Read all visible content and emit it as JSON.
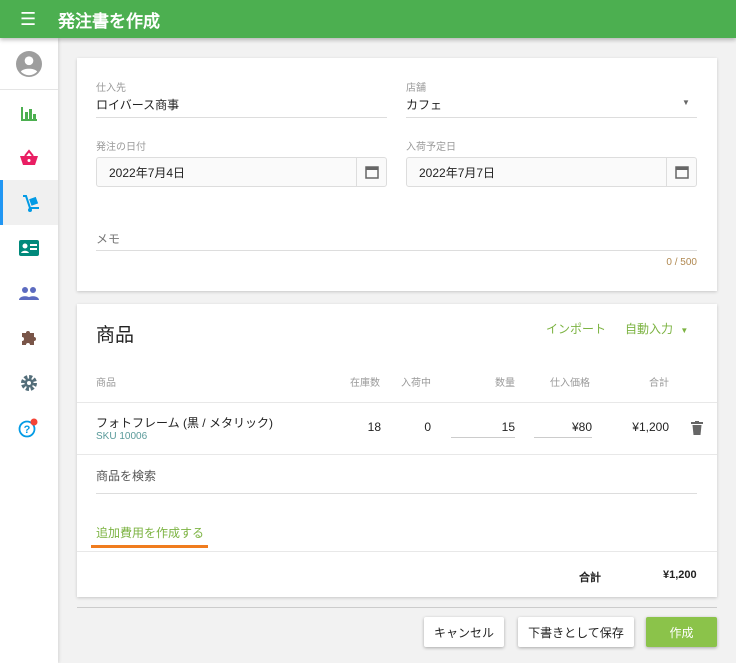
{
  "header": {
    "title": "発注書を作成",
    "menu_icon": "menu-icon"
  },
  "sidebar": {
    "items": [
      "avatar",
      "analytics",
      "shop",
      "purchase-orders",
      "customers",
      "users",
      "plugins",
      "settings",
      "help"
    ],
    "active": "purchase-orders"
  },
  "order": {
    "supplier_label": "仕入先",
    "supplier_value": "ロイバース商事",
    "store_label": "店舗",
    "store_value": "カフェ",
    "order_date_label": "発注の日付",
    "order_date_value": "2022年7月4日",
    "expected_date_label": "入荷予定日",
    "expected_date_value": "2022年7月7日",
    "memo_label": "メモ",
    "memo_counter": "0 / 500"
  },
  "items": {
    "title": "商品",
    "import_label": "インポート",
    "autofill_label": "自動入力",
    "columns": [
      "商品",
      "在庫数",
      "入荷中",
      "数量",
      "仕入価格",
      "合計"
    ],
    "rows": [
      {
        "name": "フォトフレーム (黒 / メタリック)",
        "sku": "SKU 10006",
        "stock": "18",
        "incoming": "0",
        "quantity": "15",
        "cost": "¥80",
        "total": "¥1,200"
      }
    ],
    "search_placeholder": "商品を検索",
    "add_cost_label": "追加費用を作成する",
    "total_label": "合計",
    "total_value": "¥1,200"
  },
  "actions": {
    "cancel": "キャンセル",
    "save_draft": "下書きとして保存",
    "create": "作成"
  },
  "colors": {
    "primary": "#4caf50",
    "accent": "#2196f3"
  }
}
